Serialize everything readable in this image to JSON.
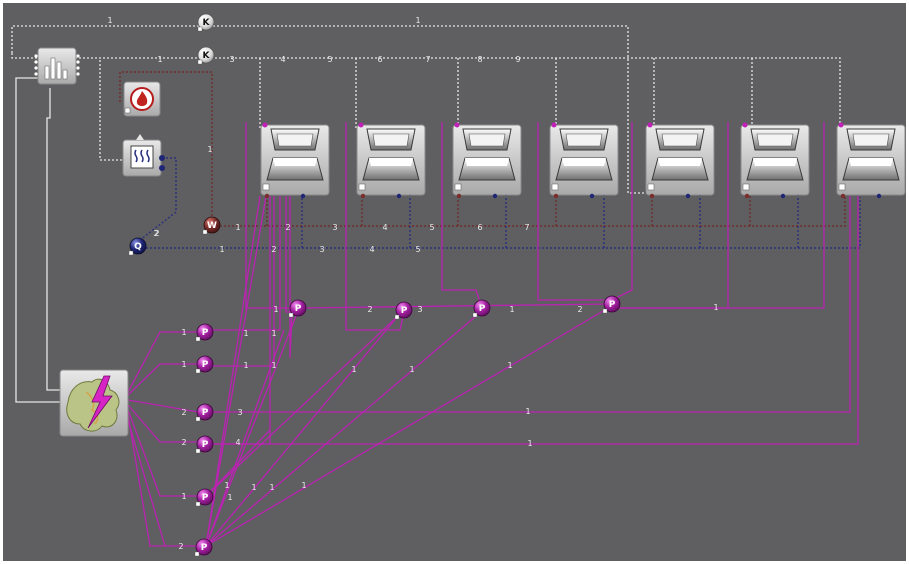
{
  "colors": {
    "background": "#5f5e61",
    "frame": "#ffffff",
    "info_link": "#e6e6e6",
    "power_link": "#c020b8",
    "waste_heat_link": "#6e2d2a",
    "heat_link": "#28307e",
    "node_purple": "#a21fa0",
    "node_brown": "#7a2d2a",
    "node_navy": "#1f2675",
    "node_white": "#f2f2f2"
  },
  "symbols": {
    "control_node": "K",
    "power_node": "P",
    "waste_heat_node": "W",
    "heat_node": "Q"
  },
  "blocks": {
    "data_source": {
      "icon": "bar-chart-icon"
    },
    "fuel_source": {
      "icon": "flame-icon"
    },
    "heat_demand": {
      "icon": "heat-radiator-icon"
    },
    "grid": {
      "icon": "europe-lightning-icon"
    },
    "units_count": 7,
    "unit_icon": "printer-unit-icon"
  },
  "labels": {
    "ctrl_top_label": "1",
    "ctrl_bottom_labels": [
      "3",
      "4",
      "5",
      "6",
      "7",
      "8",
      "9",
      "1"
    ],
    "left_trunk_label": "2",
    "waste_heat_vertical": "1",
    "waste_heat_bus": [
      "1",
      "2",
      "3",
      "4",
      "5",
      "6",
      "7"
    ],
    "heat_bus": [
      "2",
      "1",
      "2",
      "3",
      "4",
      "5"
    ],
    "power_bus": [
      "1",
      "2",
      "3",
      "1",
      "2",
      "1",
      "2",
      "3"
    ],
    "grid_links": [
      "1",
      "1",
      "1",
      "1",
      "1",
      "1",
      "1",
      "1",
      "1",
      "1",
      "1",
      "1",
      "1"
    ],
    "grid_power_labels": [
      "1",
      "1",
      "2",
      "2",
      "1",
      "2",
      "3",
      "4",
      "1",
      "1",
      "1",
      "1"
    ]
  }
}
